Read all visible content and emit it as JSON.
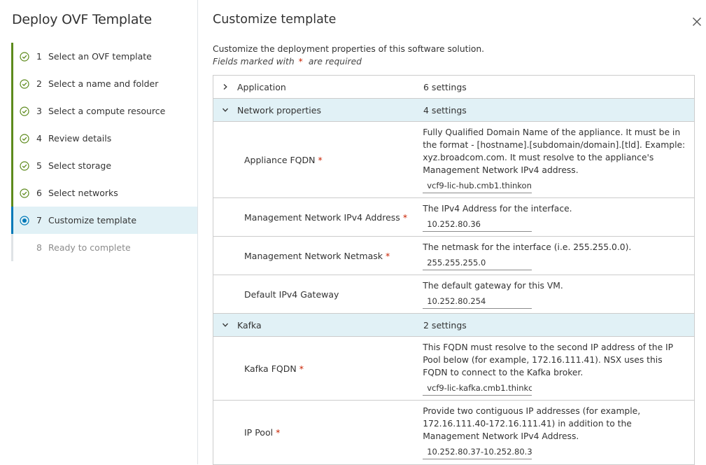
{
  "wizard": {
    "title": "Deploy OVF Template",
    "steps": [
      {
        "num": "1",
        "label": "Select an OVF template",
        "state": "done"
      },
      {
        "num": "2",
        "label": "Select a name and folder",
        "state": "done"
      },
      {
        "num": "3",
        "label": "Select a compute resource",
        "state": "done"
      },
      {
        "num": "4",
        "label": "Review details",
        "state": "done"
      },
      {
        "num": "5",
        "label": "Select storage",
        "state": "done"
      },
      {
        "num": "6",
        "label": "Select networks",
        "state": "done"
      },
      {
        "num": "7",
        "label": "Customize template",
        "state": "active"
      },
      {
        "num": "8",
        "label": "Ready to complete",
        "state": "pending"
      }
    ]
  },
  "main": {
    "title": "Customize template",
    "description": "Customize the deployment properties of this software solution.",
    "required_prefix": "Fields marked with",
    "required_star": "*",
    "required_suffix": "are required"
  },
  "groups": {
    "application": {
      "name": "Application",
      "count": "6 settings"
    },
    "network": {
      "name": "Network properties",
      "count": "4 settings"
    },
    "kafka": {
      "name": "Kafka",
      "count": "2 settings"
    }
  },
  "fields": {
    "fqdn": {
      "label": "Appliance FQDN",
      "star": "*",
      "help": "Fully Qualified Domain Name of the appliance. It must be in the format - [hostname].[subdomain/domain].[tld]. Example: xyz.broadcom.com. It  must resolve to the appliance's Management Network IPv4 address.",
      "value": "vcf9-lic-hub.cmb1.thinkon"
    },
    "mgmt_ip": {
      "label": "Management Network IPv4 Address",
      "star": "*",
      "help": "The IPv4 Address for the interface.",
      "value": "10.252.80.36"
    },
    "netmask": {
      "label": "Management Network Netmask",
      "star": "*",
      "help": "The netmask for the interface (i.e. 255.255.0.0).",
      "value": "255.255.255.0"
    },
    "gateway": {
      "label": "Default IPv4 Gateway",
      "help": "The default gateway for this VM.",
      "value": "10.252.80.254"
    },
    "kafka_fqdn": {
      "label": "Kafka FQDN",
      "star": "*",
      "help": "This FQDN must resolve to the second IP address of the IP Pool below (for example, 172.16.111.41). NSX uses this FQDN to connect to the Kafka broker.",
      "value": "vcf9-lic-kafka.cmb1.thinkc"
    },
    "ip_pool": {
      "label": "IP Pool",
      "star": "*",
      "help": "Provide two contiguous IP addresses (for example, 172.16.111.40-172.16.111.41) in addition to the Management Network IPv4 Address.",
      "value": "10.252.80.37-10.252.80.3"
    }
  },
  "colors": {
    "done": "#5d8a1c",
    "active": "#0079b8",
    "required": "#c92100",
    "highlight": "#e1f1f6"
  },
  "icons": {
    "done": "check-circle-icon",
    "active": "radio-dot-icon",
    "close": "close-icon",
    "collapsed": "chevron-right-icon",
    "expanded": "chevron-down-icon"
  }
}
